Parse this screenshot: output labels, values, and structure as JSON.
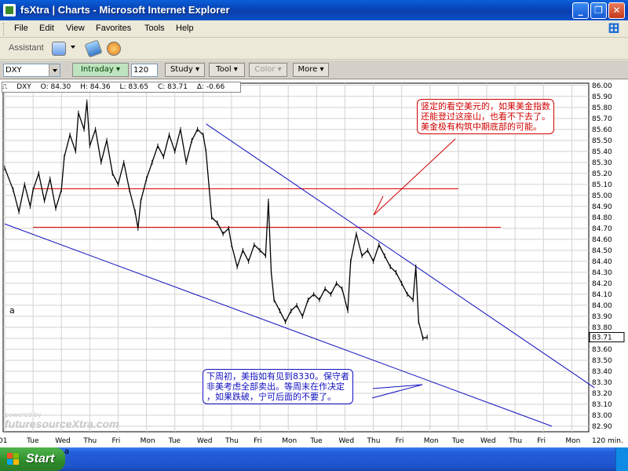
{
  "window": {
    "title": "fsXtra | Charts - Microsoft Internet Explorer",
    "min_glyph": "_",
    "max_glyph": "❐",
    "close_glyph": "✕"
  },
  "menu": [
    "File",
    "Edit",
    "View",
    "Favorites",
    "Tools",
    "Help"
  ],
  "assistant": {
    "label": "Assistant",
    "icons": [
      "mail-icon",
      "link-icon",
      "note-icon"
    ]
  },
  "chart_toolbar": {
    "symbol": "DXY",
    "interval_button": "Intraday",
    "interval_value": "120",
    "buttons": [
      "Study",
      "Tool",
      "Color",
      "More"
    ],
    "disabled": [
      "Color"
    ]
  },
  "quote": {
    "symbol": "DXY",
    "open": "O: 84.30",
    "high": "H: 84.36",
    "low": "L: 83.65",
    "close": "C: 83.71",
    "change": "Δ: -0.66"
  },
  "notes": {
    "red": [
      "竖定的看空美元的，如果美金指数",
      "还能登过这座山，也看不下去了。",
      "美金极有构筑中期底部的可能。"
    ],
    "blue": [
      "下周初，美指如有见到8330。保守者",
      "非美考虑全部卖出。等周末在作决定",
      "，如果跌破，宁可后面的不要了。"
    ]
  },
  "watermark": {
    "small": "powered by",
    "brand": "futuresourceXtra.com"
  },
  "side_label": "a",
  "taskbar": {
    "start": "Start",
    "tray_label": "a"
  },
  "chart_data": {
    "type": "line",
    "title": "",
    "xlabel": "",
    "ylabel": "",
    "interval_label": "120 min.",
    "last_price": "83.71",
    "ylim": [
      82.85,
      86.02
    ],
    "yticks": [
      86.0,
      85.9,
      85.8,
      85.7,
      85.6,
      85.5,
      85.4,
      85.3,
      85.2,
      85.1,
      85.0,
      84.9,
      84.8,
      84.7,
      84.6,
      84.5,
      84.4,
      84.3,
      84.2,
      84.1,
      84.0,
      83.9,
      83.8,
      83.7,
      83.6,
      83.5,
      83.4,
      83.3,
      83.2,
      83.1,
      83.0,
      82.9
    ],
    "xticks": [
      "01",
      "Tue",
      "Wed",
      "Thu",
      "Fri",
      "Mon",
      "Tue",
      "Wed",
      "Thu",
      "Fri",
      "Mon",
      "Tue",
      "Wed",
      "Thu",
      "Fri",
      "Mon",
      "Tue",
      "Wed",
      "Thu",
      "Fri",
      "Mon"
    ],
    "price_path": [
      [
        0,
        85.25
      ],
      [
        0.3,
        85.05
      ],
      [
        0.5,
        84.85
      ],
      [
        0.7,
        85.1
      ],
      [
        0.9,
        84.9
      ],
      [
        1.0,
        85.05
      ],
      [
        1.2,
        85.2
      ],
      [
        1.4,
        84.95
      ],
      [
        1.6,
        85.15
      ],
      [
        1.8,
        84.88
      ],
      [
        2.0,
        85.05
      ],
      [
        2.1,
        85.35
      ],
      [
        2.3,
        85.55
      ],
      [
        2.5,
        85.4
      ],
      [
        2.6,
        85.75
      ],
      [
        2.8,
        85.6
      ],
      [
        2.9,
        85.85
      ],
      [
        3.0,
        85.45
      ],
      [
        3.2,
        85.6
      ],
      [
        3.4,
        85.3
      ],
      [
        3.6,
        85.5
      ],
      [
        3.8,
        85.2
      ],
      [
        4.0,
        85.1
      ],
      [
        4.2,
        85.3
      ],
      [
        4.4,
        85.05
      ],
      [
        4.6,
        84.85
      ],
      [
        4.7,
        84.7
      ],
      [
        4.8,
        84.95
      ],
      [
        5.0,
        85.15
      ],
      [
        5.2,
        85.3
      ],
      [
        5.4,
        85.45
      ],
      [
        5.6,
        85.35
      ],
      [
        5.8,
        85.55
      ],
      [
        6.0,
        85.4
      ],
      [
        6.2,
        85.6
      ],
      [
        6.4,
        85.3
      ],
      [
        6.6,
        85.5
      ],
      [
        6.8,
        85.6
      ],
      [
        7.0,
        85.55
      ],
      [
        7.1,
        85.4
      ],
      [
        7.3,
        84.8
      ],
      [
        7.5,
        84.75
      ],
      [
        7.7,
        84.65
      ],
      [
        7.9,
        84.7
      ],
      [
        8.0,
        84.55
      ],
      [
        8.2,
        84.35
      ],
      [
        8.4,
        84.5
      ],
      [
        8.6,
        84.4
      ],
      [
        8.8,
        84.55
      ],
      [
        9.0,
        84.5
      ],
      [
        9.2,
        84.45
      ],
      [
        9.3,
        84.95
      ],
      [
        9.4,
        84.3
      ],
      [
        9.5,
        84.05
      ],
      [
        9.7,
        83.95
      ],
      [
        9.9,
        83.85
      ],
      [
        10.1,
        83.95
      ],
      [
        10.3,
        84.0
      ],
      [
        10.5,
        83.9
      ],
      [
        10.7,
        84.05
      ],
      [
        10.9,
        84.1
      ],
      [
        11.1,
        84.05
      ],
      [
        11.3,
        84.15
      ],
      [
        11.5,
        84.1
      ],
      [
        11.7,
        84.2
      ],
      [
        11.9,
        84.15
      ],
      [
        12.1,
        83.95
      ],
      [
        12.2,
        84.4
      ],
      [
        12.4,
        84.65
      ],
      [
        12.6,
        84.45
      ],
      [
        12.8,
        84.5
      ],
      [
        13.0,
        84.4
      ],
      [
        13.2,
        84.55
      ],
      [
        13.4,
        84.45
      ],
      [
        13.6,
        84.35
      ],
      [
        13.8,
        84.3
      ],
      [
        14.0,
        84.2
      ],
      [
        14.2,
        84.1
      ],
      [
        14.4,
        84.05
      ],
      [
        14.5,
        84.35
      ],
      [
        14.6,
        83.85
      ],
      [
        14.75,
        83.7
      ],
      [
        14.9,
        83.71
      ]
    ],
    "hlines": [
      {
        "y": 85.06,
        "x_from": 1.0,
        "x_to": 16.0,
        "color": "#e00000"
      },
      {
        "y": 84.71,
        "x_from": 1.0,
        "x_to": 17.5,
        "color": "#e00000"
      }
    ],
    "trendlines": [
      {
        "from": [
          0,
          84.74
        ],
        "to": [
          19.3,
          82.9
        ],
        "color": "#1010c0"
      },
      {
        "from": [
          7.1,
          85.65
        ],
        "to": [
          20.8,
          83.25
        ],
        "color": "#1010c0"
      }
    ],
    "grid": true
  }
}
